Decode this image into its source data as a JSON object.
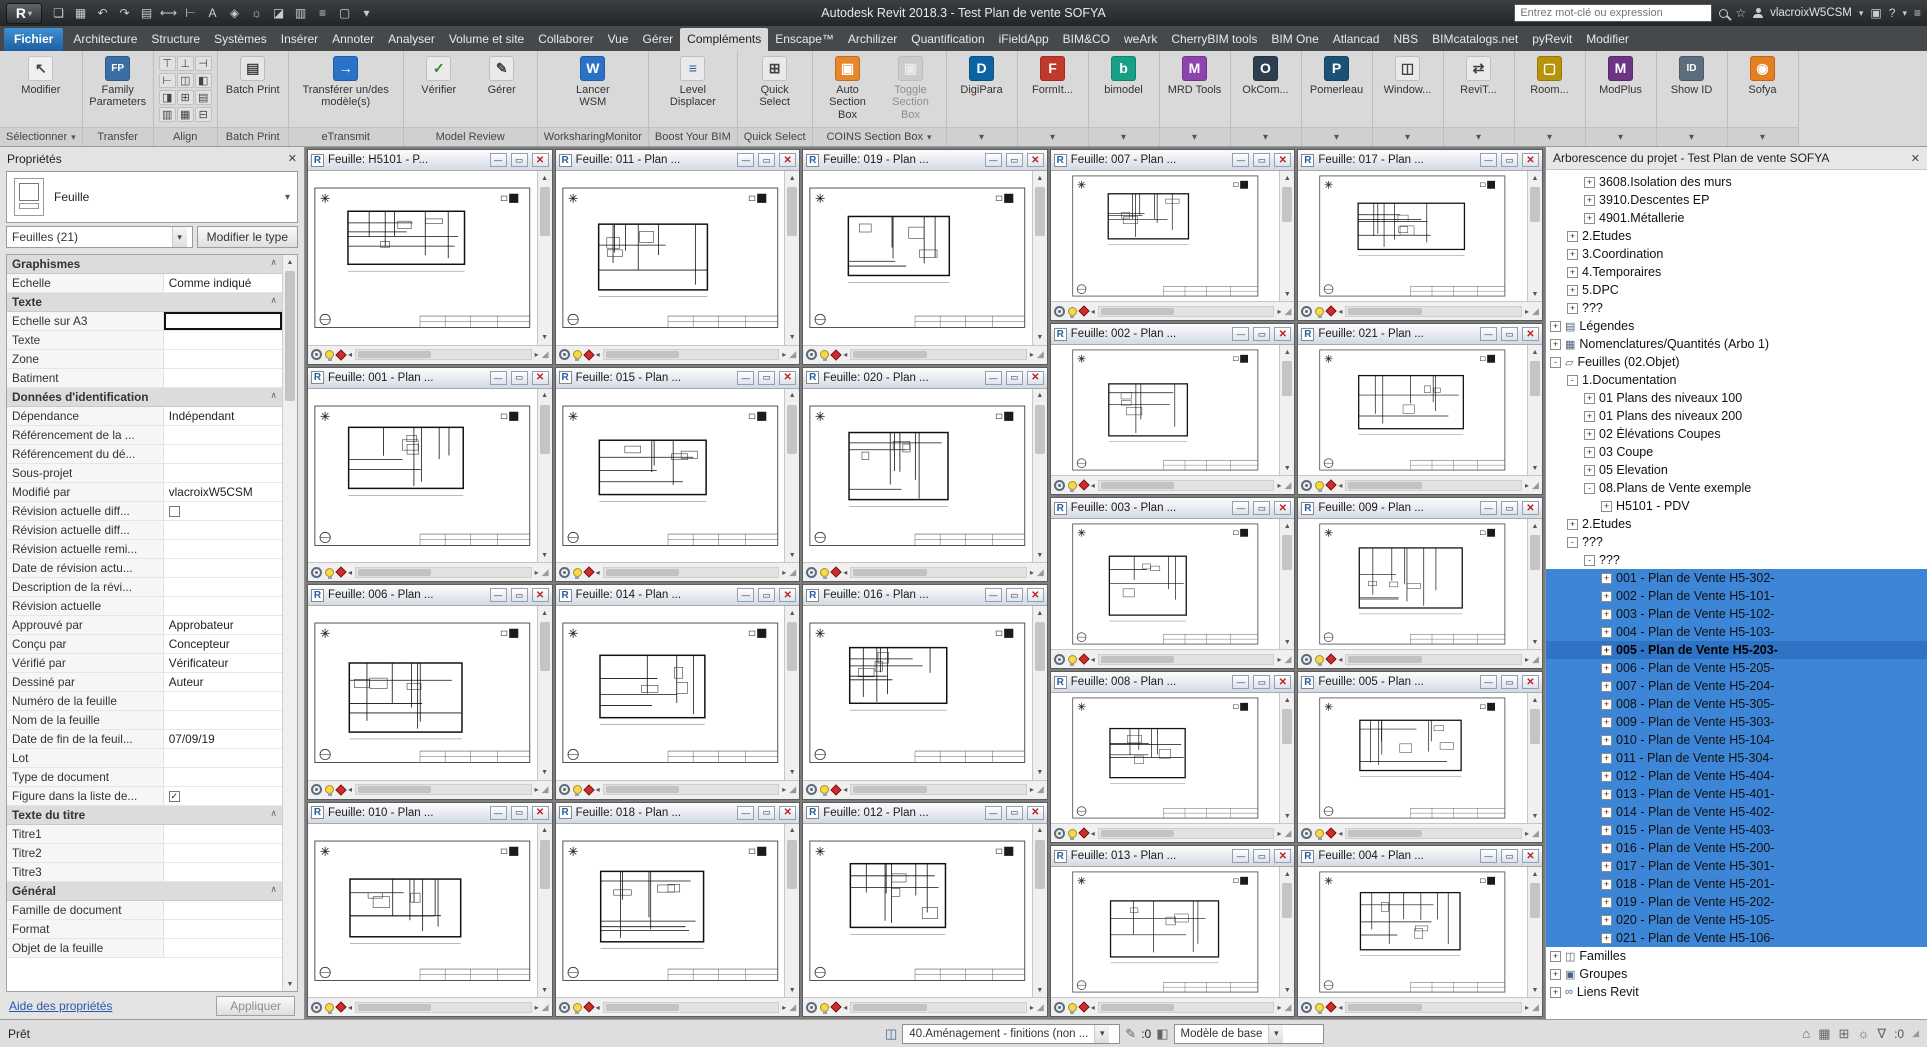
{
  "app": {
    "title": "Autodesk Revit 2018.3  -  Test Plan de vente SOFYA"
  },
  "titlebar": {
    "search_placeholder": "Entrez mot-clé ou expression",
    "username": "vlacroixW5CSM",
    "qat_icons": [
      "open",
      "save",
      "undo",
      "redo",
      "print",
      "measure",
      "aligned-dimension",
      "text",
      "default-3d-view",
      "sun-settings",
      "section",
      "schedule",
      "thin-lines",
      "switch-windows",
      "customize-qat"
    ]
  },
  "ribbon": {
    "tabs": [
      "Fichier",
      "Architecture",
      "Structure",
      "Systèmes",
      "Insérer",
      "Annoter",
      "Analyser",
      "Volume et site",
      "Collaborer",
      "Vue",
      "Gérer",
      "Compléments",
      "Enscape™",
      "Archilizer",
      "Quantification",
      "iFieldApp",
      "BIM&CO",
      "weArk",
      "CherryBIM tools",
      "BIM One",
      "Atlancad",
      "NBS",
      "BIMcatalogs.net",
      "pyRevit",
      "Modifier"
    ],
    "file_tab": "Fichier",
    "active_tab": "Compléments",
    "panels": [
      {
        "label": "Sélectionner",
        "menu": true,
        "buttons": [
          {
            "label": "Modifier",
            "icon": "modify-cursor"
          }
        ]
      },
      {
        "label": "Transfer",
        "buttons": [
          {
            "label": "Family Parameters",
            "icon": "family-parameters"
          }
        ]
      },
      {
        "label": "Align",
        "align_icons": [
          "⊤",
          "⊥",
          "⊣",
          "⊢",
          "◫",
          "◧",
          "◨",
          "⊞",
          "▤",
          "▥",
          "▦",
          "⊟"
        ]
      },
      {
        "label": "Batch Print",
        "buttons": [
          {
            "label": "Batch Print",
            "icon": "printer"
          }
        ]
      },
      {
        "label": "eTransmit",
        "buttons": [
          {
            "label": "Transférer un/des modèle(s)",
            "icon": "etransmit",
            "wide": true
          }
        ]
      },
      {
        "label": "Model Review",
        "buttons": [
          {
            "label": "Vérifier",
            "icon": "verify"
          },
          {
            "label": "Gérer",
            "icon": "manage"
          }
        ]
      },
      {
        "label": "WorksharingMonitor",
        "buttons": [
          {
            "label": "Lancer WSM",
            "icon": "wsm"
          }
        ]
      },
      {
        "label": "Boost Your BIM",
        "buttons": [
          {
            "label": "Level Displacer",
            "icon": "level-displacer"
          }
        ]
      },
      {
        "label": "Quick Select",
        "buttons": [
          {
            "label": "Quick Select",
            "icon": "quick-select"
          }
        ]
      },
      {
        "label": "COINS Section Box",
        "menu": true,
        "buttons": [
          {
            "label": "Auto Section Box",
            "icon": "auto-section-box"
          },
          {
            "label": "Toggle Section Box",
            "icon": "toggle-section-box",
            "disabled": true
          }
        ]
      },
      {
        "flyout": true,
        "buttons": [
          {
            "label": "DigiPara",
            "icon": "digipara"
          }
        ]
      },
      {
        "flyout": true,
        "buttons": [
          {
            "label": "FormIt...",
            "icon": "formit"
          }
        ]
      },
      {
        "flyout": true,
        "buttons": [
          {
            "label": "bimodel",
            "icon": "bimodel"
          }
        ]
      },
      {
        "flyout": true,
        "buttons": [
          {
            "label": "MRD Tools",
            "icon": "mrd-tools"
          }
        ]
      },
      {
        "flyout": true,
        "buttons": [
          {
            "label": "OkCom...",
            "icon": "okcom"
          }
        ]
      },
      {
        "flyout": true,
        "buttons": [
          {
            "label": "Pomerleau",
            "icon": "pomerleau"
          }
        ]
      },
      {
        "flyout": true,
        "buttons": [
          {
            "label": "Window...",
            "icon": "window-tools"
          }
        ]
      },
      {
        "flyout": true,
        "buttons": [
          {
            "label": "ReviT...",
            "icon": "revit-tools"
          }
        ]
      },
      {
        "flyout": true,
        "buttons": [
          {
            "label": "Room...",
            "icon": "room-tools"
          }
        ]
      },
      {
        "flyout": true,
        "buttons": [
          {
            "label": "ModPlus",
            "icon": "modplus"
          }
        ]
      },
      {
        "flyout": true,
        "buttons": [
          {
            "label": "Show ID",
            "icon": "show-id"
          }
        ]
      },
      {
        "flyout": true,
        "buttons": [
          {
            "label": "Sofya",
            "icon": "sofya"
          }
        ]
      }
    ]
  },
  "properties": {
    "title": "Propriétés",
    "type_name": "Feuille",
    "selector": "Feuilles (21)",
    "edit_type": "Modifier le type",
    "help_link": "Aide des propriétés",
    "apply": "Appliquer",
    "rows": [
      {
        "type": "section",
        "label": "Graphismes"
      },
      {
        "type": "row",
        "label": "Echelle",
        "value": "Comme indiqué"
      },
      {
        "type": "section",
        "label": "Texte"
      },
      {
        "type": "row",
        "label": "Echelle sur A3",
        "value": "",
        "editing": true
      },
      {
        "type": "row",
        "label": "Texte",
        "value": ""
      },
      {
        "type": "row",
        "label": "Zone",
        "value": ""
      },
      {
        "type": "row",
        "label": "Batiment",
        "value": ""
      },
      {
        "type": "section",
        "label": "Données d'identification"
      },
      {
        "type": "row",
        "label": "Dépendance",
        "value": "Indépendant"
      },
      {
        "type": "row",
        "label": "Référencement de la ...",
        "value": ""
      },
      {
        "type": "row",
        "label": "Référencement du dé...",
        "value": ""
      },
      {
        "type": "row",
        "label": "Sous-projet",
        "value": ""
      },
      {
        "type": "row",
        "label": "Modifié par",
        "value": "vlacroixW5CSM"
      },
      {
        "type": "row",
        "label": "Révision actuelle diff...",
        "checkbox": true,
        "checked": false
      },
      {
        "type": "row",
        "label": "Révision actuelle diff...",
        "value": ""
      },
      {
        "type": "row",
        "label": "Révision actuelle remi...",
        "value": ""
      },
      {
        "type": "row",
        "label": "Date de révision actu...",
        "value": ""
      },
      {
        "type": "row",
        "label": "Description de la révi...",
        "value": ""
      },
      {
        "type": "row",
        "label": "Révision actuelle",
        "value": ""
      },
      {
        "type": "row",
        "label": "Approuvé par",
        "value": "Approbateur"
      },
      {
        "type": "row",
        "label": "Conçu par",
        "value": "Concepteur"
      },
      {
        "type": "row",
        "label": "Vérifié par",
        "value": "Vérificateur"
      },
      {
        "type": "row",
        "label": "Dessiné par",
        "value": "Auteur"
      },
      {
        "type": "row",
        "label": "Numéro de la feuille",
        "value": ""
      },
      {
        "type": "row",
        "label": "Nom de la feuille",
        "value": ""
      },
      {
        "type": "row",
        "label": "Date de fin de la feuil...",
        "value": "07/09/19"
      },
      {
        "type": "row",
        "label": "Lot",
        "value": ""
      },
      {
        "type": "row",
        "label": "Type de document",
        "value": ""
      },
      {
        "type": "row",
        "label": "Figure dans la liste de...",
        "checkbox": true,
        "checked": true
      },
      {
        "type": "section",
        "label": "Texte du titre"
      },
      {
        "type": "row",
        "label": "Titre1",
        "value": ""
      },
      {
        "type": "row",
        "label": "Titre2",
        "value": ""
      },
      {
        "type": "row",
        "label": "Titre3",
        "value": ""
      },
      {
        "type": "section",
        "label": "Général"
      },
      {
        "type": "row",
        "label": "Famille de document",
        "value": ""
      },
      {
        "type": "row",
        "label": "Format",
        "value": ""
      },
      {
        "type": "row",
        "label": "Objet de la feuille",
        "value": ""
      }
    ]
  },
  "mdi": {
    "columns": [
      {
        "windows": [
          {
            "title": "Feuille: H5101 - P..."
          },
          {
            "title": "Feuille: 001 - Plan ..."
          },
          {
            "title": "Feuille: 006 - Plan ..."
          },
          {
            "title": "Feuille: 010 - Plan ..."
          }
        ]
      },
      {
        "windows": [
          {
            "title": "Feuille: 011 - Plan ..."
          },
          {
            "title": "Feuille: 015 - Plan ..."
          },
          {
            "title": "Feuille: 014 - Plan ..."
          },
          {
            "title": "Feuille: 018 - Plan ..."
          }
        ]
      },
      {
        "windows": [
          {
            "title": "Feuille: 019 - Plan ..."
          },
          {
            "title": "Feuille: 020 - Plan ..."
          },
          {
            "title": "Feuille: 016 - Plan ..."
          },
          {
            "title": "Feuille: 012 - Plan ..."
          }
        ]
      },
      {
        "windows": [
          {
            "title": "Feuille: 007 - Plan ..."
          },
          {
            "title": "Feuille: 002 - Plan ..."
          },
          {
            "title": "Feuille: 003 - Plan ..."
          },
          {
            "title": "Feuille: 008 - Plan ..."
          },
          {
            "title": "Feuille: 013 - Plan ..."
          }
        ]
      },
      {
        "windows": [
          {
            "title": "Feuille: 017 - Plan ..."
          },
          {
            "title": "Feuille: 021 - Plan ..."
          },
          {
            "title": "Feuille: 009 - Plan ..."
          },
          {
            "title": "Feuille: 005 - Plan ..."
          },
          {
            "title": "Feuille: 004 - Plan ..."
          }
        ]
      }
    ]
  },
  "browser": {
    "title": "Arborescence du projet - Test Plan de vente SOFYA",
    "items": [
      {
        "label": "3608.Isolation des murs",
        "level": 3,
        "expand": "plus"
      },
      {
        "label": "3910.Descentes EP",
        "level": 3,
        "expand": "plus"
      },
      {
        "label": "4901.Métallerie",
        "level": 3,
        "expand": "plus"
      },
      {
        "label": "2.Etudes",
        "level": 2,
        "expand": "plus"
      },
      {
        "label": "3.Coordination",
        "level": 2,
        "expand": "plus"
      },
      {
        "label": "4.Temporaires",
        "level": 2,
        "expand": "plus"
      },
      {
        "label": "5.DPC",
        "level": 2,
        "expand": "plus"
      },
      {
        "label": "???",
        "level": 2,
        "expand": "plus"
      },
      {
        "label": "Légendes",
        "level": 1,
        "expand": "plus",
        "icon": "legend"
      },
      {
        "label": "Nomenclatures/Quantités (Arbo 1)",
        "level": 1,
        "expand": "plus",
        "icon": "schedule"
      },
      {
        "label": "Feuilles (02.Objet)",
        "level": 1,
        "expand": "minus",
        "icon": "sheet"
      },
      {
        "label": "1.Documentation",
        "level": 2,
        "expand": "minus"
      },
      {
        "label": "01 Plans des niveaux 100",
        "level": 3,
        "expand": "plus"
      },
      {
        "label": "01 Plans des niveaux 200",
        "level": 3,
        "expand": "plus"
      },
      {
        "label": "02 Élévations Coupes",
        "level": 3,
        "expand": "plus"
      },
      {
        "label": "03 Coupe",
        "level": 3,
        "expand": "plus"
      },
      {
        "label": "05 Elevation",
        "level": 3,
        "expand": "plus"
      },
      {
        "label": "08.Plans de Vente exemple",
        "level": 3,
        "expand": "minus"
      },
      {
        "label": "H5101 - PDV",
        "level": 4,
        "expand": "plus"
      },
      {
        "label": "2.Etudes",
        "level": 2,
        "expand": "plus"
      },
      {
        "label": "???",
        "level": 2,
        "expand": "minus"
      },
      {
        "label": "???",
        "level": 3,
        "expand": "minus"
      },
      {
        "label": "001 - Plan de Vente H5-302-",
        "level": 4,
        "expand": "plus",
        "selected": true
      },
      {
        "label": "002 - Plan de Vente H5-101-",
        "level": 4,
        "expand": "plus",
        "selected": true
      },
      {
        "label": "003 - Plan de Vente H5-102-",
        "level": 4,
        "expand": "plus",
        "selected": true
      },
      {
        "label": "004 - Plan de Vente H5-103-",
        "level": 4,
        "expand": "plus",
        "selected": true
      },
      {
        "label": "005 - Plan de Vente H5-203-",
        "level": 4,
        "expand": "plus",
        "selected": true,
        "bold": true
      },
      {
        "label": "006 - Plan de Vente H5-205-",
        "level": 4,
        "expand": "plus",
        "selected": true
      },
      {
        "label": "007 - Plan de Vente H5-204-",
        "level": 4,
        "expand": "plus",
        "selected": true
      },
      {
        "label": "008 - Plan de Vente H5-305-",
        "level": 4,
        "expand": "plus",
        "selected": true
      },
      {
        "label": "009 - Plan de Vente H5-303-",
        "level": 4,
        "expand": "plus",
        "selected": true
      },
      {
        "label": "010 - Plan de Vente H5-104-",
        "level": 4,
        "expand": "plus",
        "selected": true
      },
      {
        "label": "011 - Plan de Vente H5-304-",
        "level": 4,
        "expand": "plus",
        "selected": true
      },
      {
        "label": "012 - Plan de Vente H5-404-",
        "level": 4,
        "expand": "plus",
        "selected": true
      },
      {
        "label": "013 - Plan de Vente H5-401-",
        "level": 4,
        "expand": "plus",
        "selected": true
      },
      {
        "label": "014 - Plan de Vente H5-402-",
        "level": 4,
        "expand": "plus",
        "selected": true
      },
      {
        "label": "015 - Plan de Vente H5-403-",
        "level": 4,
        "expand": "plus",
        "selected": true
      },
      {
        "label": "016 - Plan de Vente H5-200-",
        "level": 4,
        "expand": "plus",
        "selected": true
      },
      {
        "label": "017 - Plan de Vente H5-301-",
        "level": 4,
        "expand": "plus",
        "selected": true
      },
      {
        "label": "018 - Plan de Vente H5-201-",
        "level": 4,
        "expand": "plus",
        "selected": true
      },
      {
        "label": "019 - Plan de Vente H5-202-",
        "level": 4,
        "expand": "plus",
        "selected": true
      },
      {
        "label": "020 - Plan de Vente H5-105-",
        "level": 4,
        "expand": "plus",
        "selected": true
      },
      {
        "label": "021 - Plan de Vente H5-106-",
        "level": 4,
        "expand": "plus",
        "selected": true
      },
      {
        "label": "Familles",
        "level": 1,
        "expand": "plus",
        "icon": "families"
      },
      {
        "label": "Groupes",
        "level": 1,
        "expand": "plus",
        "icon": "groups"
      },
      {
        "label": "Liens Revit",
        "level": 1,
        "expand": "plus",
        "icon": "links"
      }
    ]
  },
  "status_bar": {
    "ready": "Prêt",
    "workset": "40.Aménagement - finitions (non ...",
    "design_option": "Modèle de base",
    "edit_count": ":0",
    "filter_count": ":0"
  }
}
